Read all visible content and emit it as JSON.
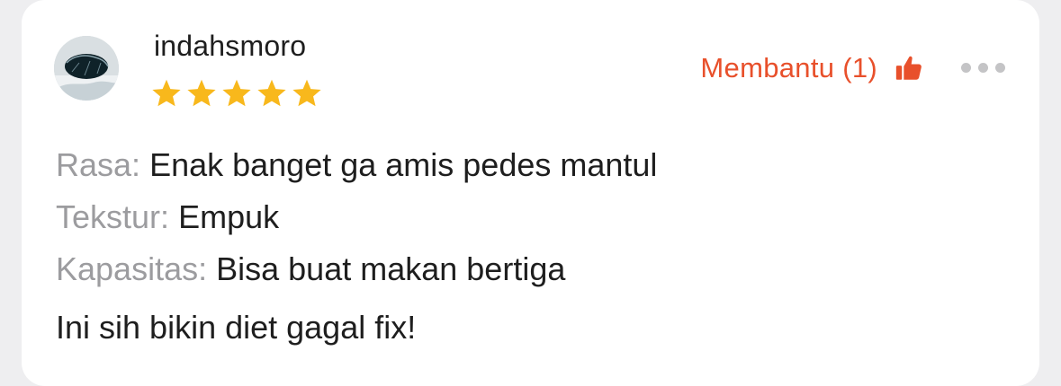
{
  "review": {
    "username": "indahsmoro",
    "rating": 5,
    "rating_max": 5,
    "avatar_icon": "user-avatar-photo",
    "helpful": {
      "label": "Membantu (1)",
      "icon": "thumbs-up-icon",
      "color": "#e8502b"
    },
    "more_icon": "more-horizontal-icon",
    "attributes": [
      {
        "key": "Rasa:",
        "value": "Enak banget ga amis pedes mantul"
      },
      {
        "key": "Tekstur:",
        "value": "Empuk"
      },
      {
        "key": "Kapasitas:",
        "value": "Bisa buat makan bertiga"
      }
    ],
    "comment": "Ini sih bikin diet gagal fix!",
    "star_color": "#f8b81c"
  }
}
